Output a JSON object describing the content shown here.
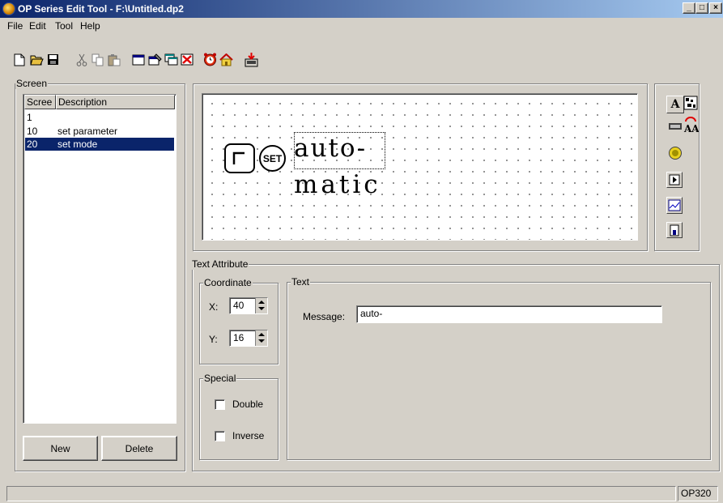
{
  "window": {
    "title": "OP Series Edit Tool - F:\\Untitled.dp2"
  },
  "menu": [
    "File",
    "Edit",
    "Tool",
    "Help"
  ],
  "toolbar": {
    "buttons": [
      "new-file-icon",
      "open-folder-icon",
      "save-disk-icon",
      "cut-icon",
      "copy-icon",
      "paste-icon",
      "window-icon",
      "properties-icon",
      "screens-icon",
      "delete-red-icon",
      "timer-icon",
      "home-icon",
      "download-icon"
    ]
  },
  "screen_panel": {
    "label": "Screen",
    "columns": [
      "Scree",
      "Description"
    ],
    "rows": [
      {
        "id": "1",
        "description": ""
      },
      {
        "id": "10",
        "description": "set parameter"
      },
      {
        "id": "20",
        "description": "set mode",
        "selected": true
      }
    ],
    "new_label": "New",
    "delete_label": "Delete"
  },
  "canvas": {
    "line1": "auto-",
    "line2": "matic",
    "set_key": "SET"
  },
  "tool_palette": [
    "text-tool-icon",
    "bitmap-tool-icon",
    "numeric-tool-icon",
    "text-switch-tool-icon",
    "lamp-tool-icon",
    "button-tool-icon",
    "trend-tool-icon",
    "bar-tool-icon"
  ],
  "text_attribute": {
    "label": "Text Attribute",
    "coordinate": {
      "label": "Coordinate",
      "x_label": "X:",
      "x": "40",
      "y_label": "Y:",
      "y": "16"
    },
    "special": {
      "label": "Special",
      "double_label": "Double",
      "inverse_label": "Inverse",
      "double": false,
      "inverse": false
    },
    "text": {
      "label": "Text",
      "message_label": "Message:",
      "message": "auto-"
    }
  },
  "status": {
    "model": "OP320"
  }
}
